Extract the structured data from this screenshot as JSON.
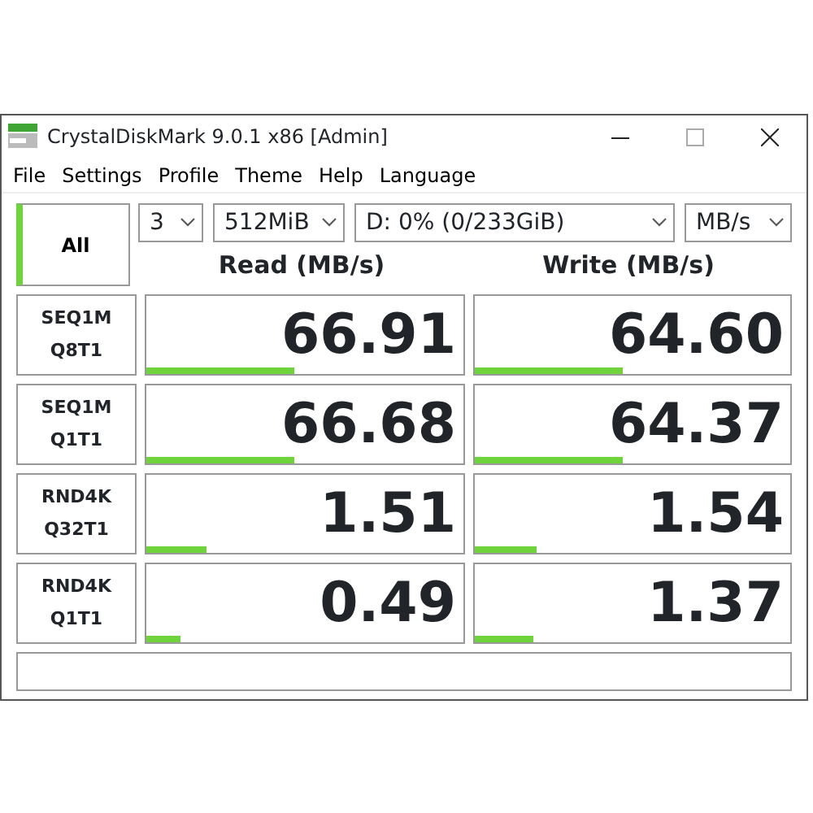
{
  "window": {
    "title": "CrystalDiskMark 9.0.1 x86 [Admin]"
  },
  "menu": [
    "File",
    "Settings",
    "Profile",
    "Theme",
    "Help",
    "Language"
  ],
  "all_button": {
    "label": "All"
  },
  "selectors": [
    {
      "value": "3"
    },
    {
      "value": "512MiB"
    },
    {
      "value": "D: 0% (0/233GiB)"
    },
    {
      "value": "MB/s"
    }
  ],
  "columns": [
    "Read (MB/s)",
    "Write (MB/s)"
  ],
  "rows": [
    {
      "test": [
        "SEQ1M",
        "Q8T1"
      ],
      "read": {
        "value": "66.91",
        "level": 0.47
      },
      "write": {
        "value": "64.60",
        "level": 0.47
      }
    },
    {
      "test": [
        "SEQ1M",
        "Q1T1"
      ],
      "read": {
        "value": "66.68",
        "level": 0.47
      },
      "write": {
        "value": "64.37",
        "level": 0.47
      }
    },
    {
      "test": [
        "RND4K",
        "Q32T1"
      ],
      "read": {
        "value": "1.51",
        "level": 0.19
      },
      "write": {
        "value": "1.54",
        "level": 0.2
      }
    },
    {
      "test": [
        "RND4K",
        "Q1T1"
      ],
      "read": {
        "value": "0.49",
        "level": 0.11
      },
      "write": {
        "value": "1.37",
        "level": 0.19
      }
    }
  ]
}
